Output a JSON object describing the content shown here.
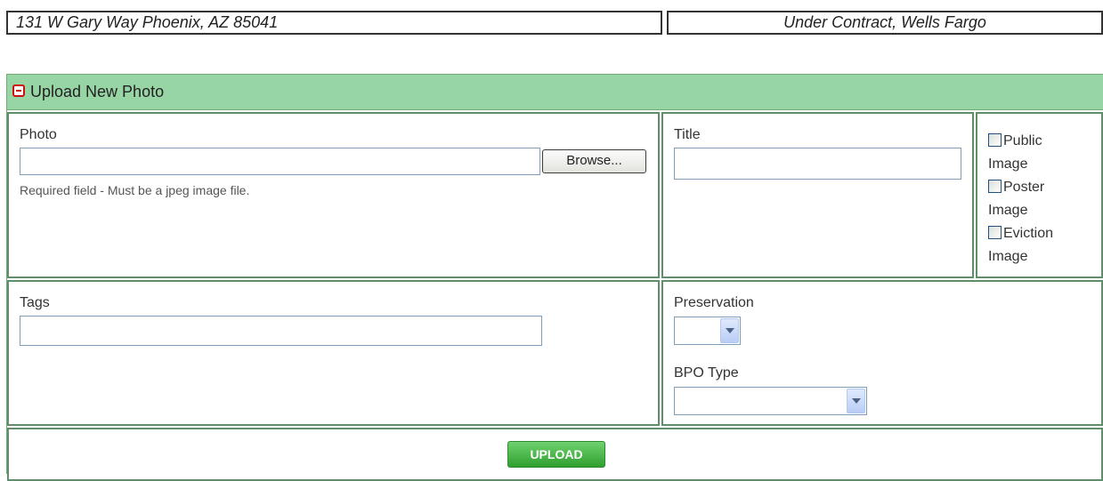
{
  "address": "131 W Gary Way Phoenix, AZ 85041",
  "status": "Under Contract, Wells Fargo",
  "panel": {
    "title": "Upload New Photo",
    "collapse_icon": "minus-square-icon",
    "accent_color": "#97d5a5"
  },
  "photo": {
    "label": "Photo",
    "value": "",
    "browse_label": "Browse...",
    "hint": "Required field - Must be a jpeg image file."
  },
  "title_field": {
    "label": "Title",
    "value": ""
  },
  "checkboxes": [
    {
      "line1": "Public",
      "line2": "Image",
      "checked": false
    },
    {
      "line1": "Poster",
      "line2": "Image",
      "checked": false
    },
    {
      "line1": "Eviction",
      "line2": "Image",
      "checked": false
    }
  ],
  "tags": {
    "label": "Tags",
    "value": ""
  },
  "preservation": {
    "label": "Preservation",
    "selected": ""
  },
  "bpo_type": {
    "label": "BPO Type",
    "selected": ""
  },
  "upload_label": "UPLOAD"
}
